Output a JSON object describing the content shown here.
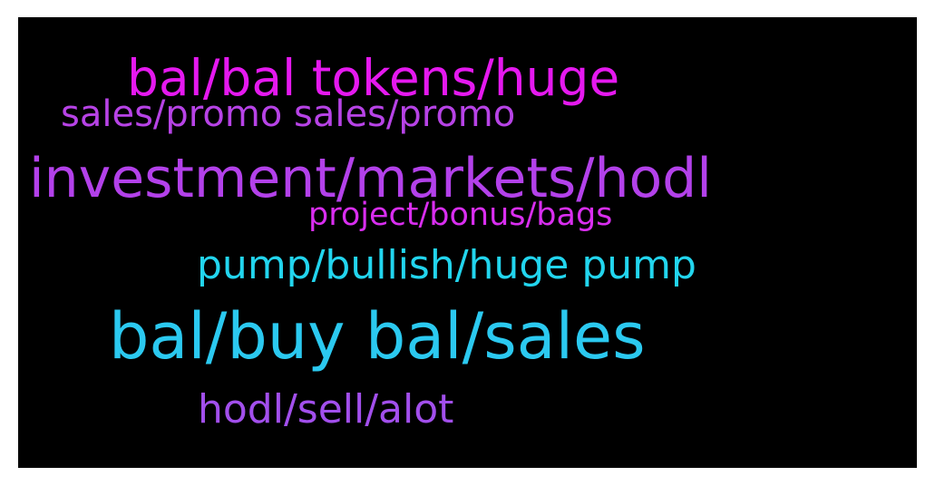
{
  "wordcloud": {
    "background": "#000000",
    "words": [
      {
        "text": "bal/bal tokens/huge",
        "color": "#e519ef"
      },
      {
        "text": "sales/promo sales/promo",
        "color": "#b743e6"
      },
      {
        "text": "investment/markets/hodl",
        "color": "#b341ea"
      },
      {
        "text": "project/bonus/bags",
        "color": "#d92ef0"
      },
      {
        "text": "pump/bullish/huge pump",
        "color": "#22d5ee"
      },
      {
        "text": "bal/buy bal/sales",
        "color": "#2bc9f0"
      },
      {
        "text": "hodl/sell/alot",
        "color": "#a24fec"
      }
    ]
  }
}
